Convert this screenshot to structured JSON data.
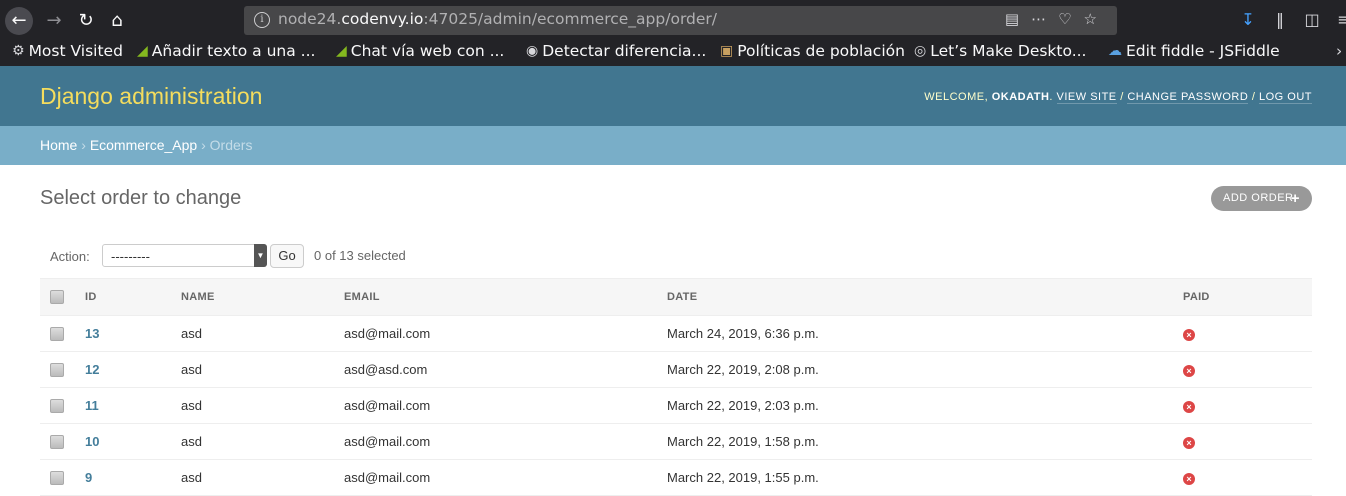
{
  "browser": {
    "url_prefix": "node24.",
    "url_host": "codenvy.io",
    "url_rest": ":47025/admin/ecommerce_app/order/",
    "bookmarks": [
      {
        "icon": "gear-icon",
        "label": "Most Visited"
      },
      {
        "icon": "green-shoe-icon",
        "label": "Añadir texto a una ..."
      },
      {
        "icon": "green-shoe-icon",
        "label": "Chat vía web con ..."
      },
      {
        "icon": "spy-icon",
        "label": "Detectar diferencia..."
      },
      {
        "icon": "image-icon",
        "label": "Políticas de población"
      },
      {
        "icon": "globe-icon",
        "label": "Let’s Make Deskto..."
      },
      {
        "icon": "cloud-icon",
        "label": "Edit fiddle - JSFiddle"
      }
    ]
  },
  "header": {
    "branding": "Django administration",
    "welcome": "Welcome,",
    "username": "okadath",
    "view_site": "View site",
    "change_password": "Change password",
    "log_out": "Log out"
  },
  "breadcrumbs": {
    "home": "Home",
    "app": "Ecommerce_App",
    "current": "Orders"
  },
  "content": {
    "title": "Select order to change",
    "add_button": "Add order",
    "action_label": "Action:",
    "action_value": "---------",
    "go_button": "Go",
    "selected_count": "0 of 13 selected"
  },
  "table": {
    "headers": [
      "ID",
      "Name",
      "Email",
      "Date",
      "Paid"
    ],
    "rows": [
      {
        "id": "13",
        "name": "asd",
        "email": "asd@mail.com",
        "date": "March 24, 2019, 6:36 p.m.",
        "paid": false
      },
      {
        "id": "12",
        "name": "asd",
        "email": "asd@asd.com",
        "date": "March 22, 2019, 2:08 p.m.",
        "paid": false
      },
      {
        "id": "11",
        "name": "asd",
        "email": "asd@mail.com",
        "date": "March 22, 2019, 2:03 p.m.",
        "paid": false
      },
      {
        "id": "10",
        "name": "asd",
        "email": "asd@mail.com",
        "date": "March 22, 2019, 1:58 p.m.",
        "paid": false
      },
      {
        "id": "9",
        "name": "asd",
        "email": "asd@mail.com",
        "date": "March 22, 2019, 1:55 p.m.",
        "paid": false
      }
    ]
  }
}
